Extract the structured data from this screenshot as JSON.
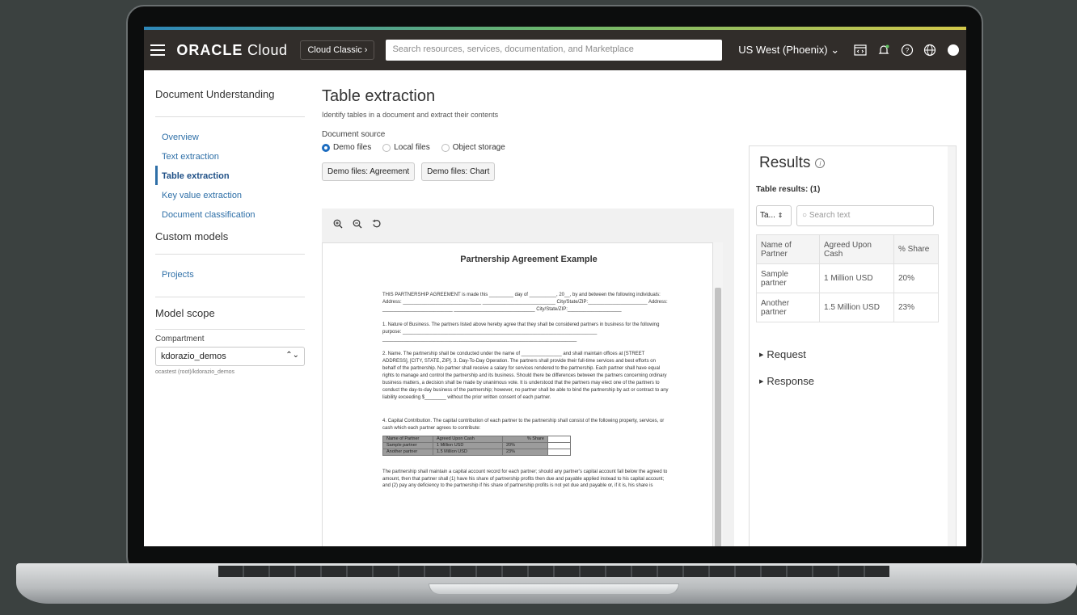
{
  "header": {
    "logo_main": "ORACLE",
    "logo_sub": "Cloud",
    "classic_label": "Cloud Classic",
    "search_placeholder": "Search resources, services, documentation, and Marketplace",
    "region_label": "US West (Phoenix)"
  },
  "sidebar": {
    "title": "Document Understanding",
    "items": [
      {
        "label": "Overview"
      },
      {
        "label": "Text extraction"
      },
      {
        "label": "Table extraction"
      },
      {
        "label": "Key value extraction"
      },
      {
        "label": "Document classification"
      }
    ],
    "custom_models_title": "Custom models",
    "projects_label": "Projects",
    "model_scope_title": "Model scope",
    "compartment_label": "Compartment",
    "compartment_value": "kdorazio_demos",
    "compartment_path": "ocastest (root)/kdorazio_demos"
  },
  "main": {
    "title": "Table extraction",
    "subtitle": "Identify tables in a document and extract their contents",
    "source_label": "Document source",
    "radios": [
      {
        "label": "Demo files"
      },
      {
        "label": "Local files"
      },
      {
        "label": "Object storage"
      }
    ],
    "demo_buttons": [
      {
        "label": "Demo files: Agreement"
      },
      {
        "label": "Demo files: Chart"
      }
    ]
  },
  "document": {
    "title": "Partnership Agreement Example",
    "para1": "THIS PARTNERSHIP AGREEMENT is made this _________ day of __________, 20__, by and between the following individuals: Address: _____________________________ ___________________________ City/State/ZIP:______________________ Address: __________________________ ______________________________ City/State/ZIP:____________________",
    "para2": "1. Nature of Business. The partners listed above hereby agree that they shall be considered partners in business for the following purpose: ________________________________________________________________________ ________________________________________________________________________",
    "para3": "2. Name. The partnership shall be conducted under the name of _______________ and shall maintain offices at [STREET ADDRESS], [CITY, STATE, ZIP]. 3. Day-To-Day Operation. The partners shall provide their full-time services and best efforts on behalf of the partnership. No partner shall receive a salary for services rendered to the partnership. Each partner shall have equal rights to manage and control the partnership and its business. Should there be differences between the partners concerning ordinary business matters, a decision shall be made by unanimous vote. It is understood that the partners may elect one of the partners to conduct the day-to-day business of the partnership; however, no partner shall be able to bind the partnership by act or contract to any liability exceeding $________ without the prior written consent of each partner.",
    "para4": "4. Capital Contribution. The capital contribution of each partner to the partnership shall consist of the following property, services, or cash which each partner agrees to contribute:",
    "table": {
      "headers": [
        "Name of Partner",
        "Agreed Upon Cash",
        "% Share"
      ],
      "rows": [
        [
          "Sample partner",
          "1 Million USD",
          "20%"
        ],
        [
          "Another partner",
          "1.5 Million USD",
          "23%"
        ]
      ]
    },
    "para5": "The partnership shall maintain a capital account record for each partner; should any partner's capital account fall below the agreed to amount, then that partner shall (1) have his share of partnership profits then due and payable applied instead to his capital account; and (2) pay any deficiency to the partnership if his share of partnership profits is not yet due and payable or, if it is, his share is"
  },
  "results": {
    "title": "Results",
    "table_results": "Table results: (1)",
    "select_value": "Ta...",
    "search_placeholder": "Search text",
    "table": {
      "headers": [
        "Name of Partner",
        "Agreed Upon Cash",
        "% Share"
      ],
      "rows": [
        [
          "Sample partner",
          "1 Million USD",
          "20%"
        ],
        [
          "Another partner",
          "1.5 Million USD",
          "23%"
        ]
      ]
    },
    "request_label": "Request",
    "response_label": "Response"
  }
}
